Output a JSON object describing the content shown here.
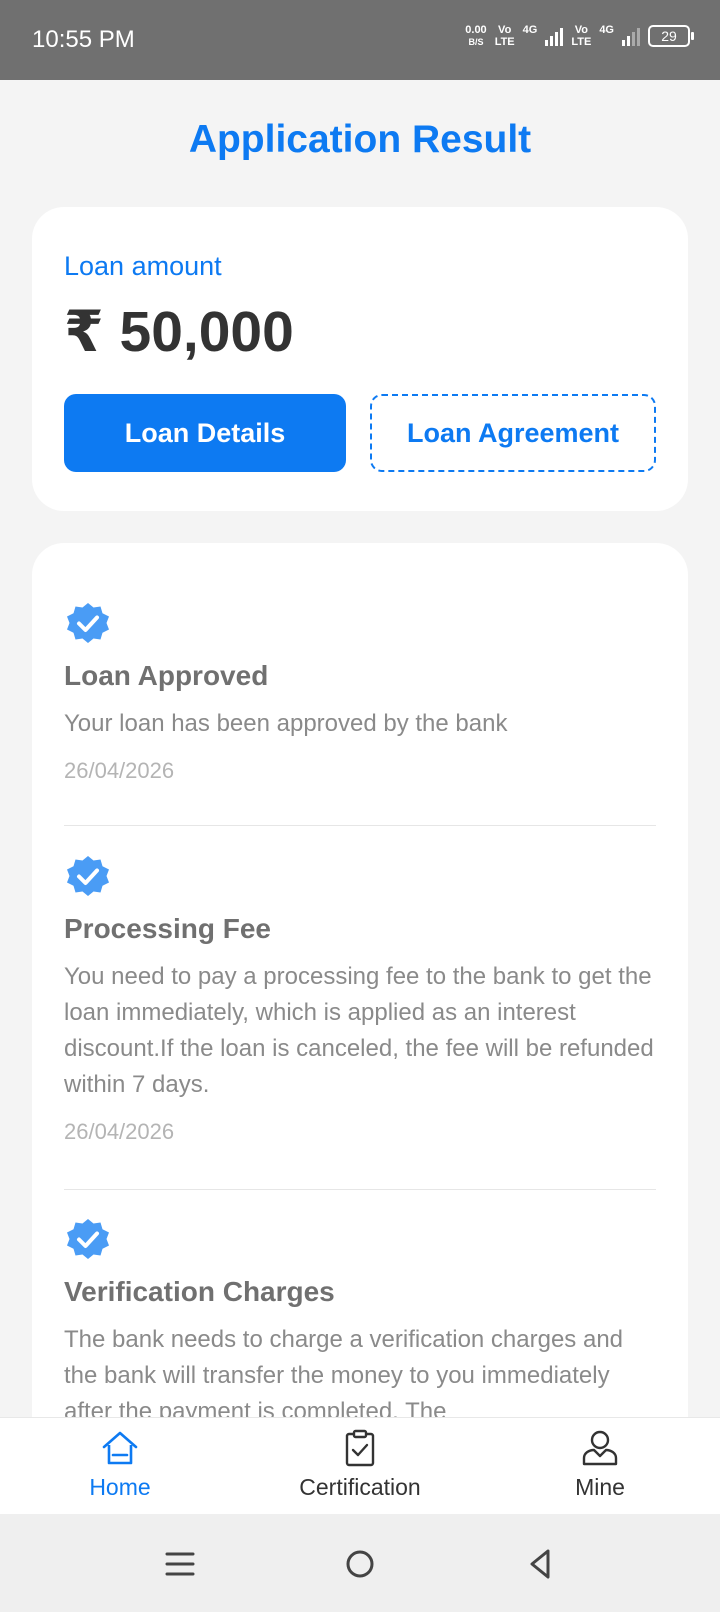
{
  "status_bar": {
    "time": "10:55 PM",
    "net_speed_value": "0.00",
    "net_speed_unit": "B/S",
    "sim1_line1": "Vo",
    "sim1_line2": "LTE",
    "sim1_gen": "4G",
    "sim2_line1": "Vo",
    "sim2_line2": "LTE",
    "sim2_gen": "4G",
    "battery": "29"
  },
  "page": {
    "title": "Application Result"
  },
  "loan": {
    "amount_label": "Loan amount",
    "amount_value": "₹ 50,000",
    "details_button": "Loan Details",
    "agreement_button": "Loan Agreement"
  },
  "timeline": [
    {
      "title": "Loan Approved",
      "description": "Your loan has been approved by the bank",
      "date": "26/04/2026"
    },
    {
      "title": "Processing Fee",
      "description": "You need to pay a processing fee to the bank to get the loan immediately, which is applied as an interest discount.If the loan is canceled, the fee will be refunded within 7 days.",
      "date": "26/04/2026"
    },
    {
      "title": "Verification Charges",
      "description": "The bank needs to charge a verification charges and the bank will transfer the money to you immediately after the payment is completed. The"
    }
  ],
  "nav": {
    "home": "Home",
    "certification": "Certification",
    "mine": "Mine"
  },
  "colors": {
    "accent": "#0d7af2",
    "check_badge": "#4a9cf5"
  },
  "icons": {
    "check_badge": "verified-check-icon",
    "home": "home-icon",
    "certification": "clipboard-check-icon",
    "mine": "user-icon"
  }
}
